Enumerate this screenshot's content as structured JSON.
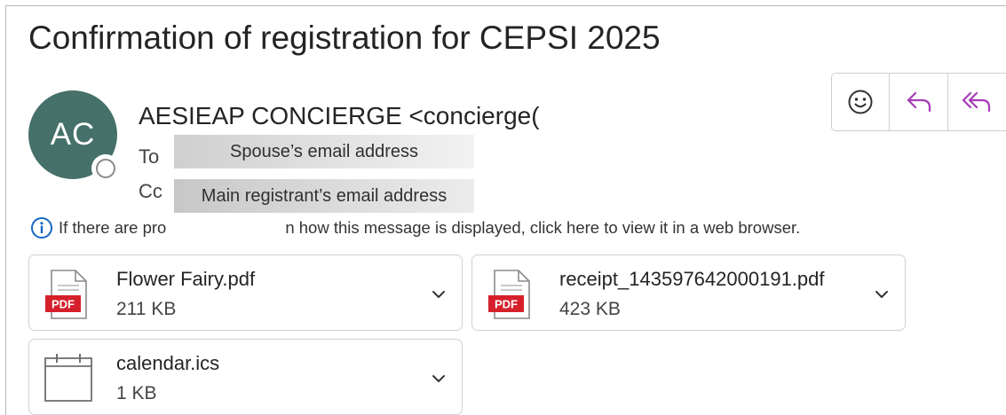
{
  "message": {
    "subject": "Confirmation of registration for CEPSI 2025",
    "sender": {
      "initials": "AC",
      "display": "AESIEAP CONCIERGE <concierge("
    },
    "recipients": {
      "to_label": "To",
      "to_value": "Spouse’s email address",
      "cc_label": "Cc",
      "cc_value": "Main registrant’s email address"
    },
    "info_bar": {
      "text_start": "If there are pro",
      "text_end": "n how this message is displayed, click here to view it in a web browser."
    }
  },
  "attachments": [
    {
      "name": "Flower Fairy.pdf",
      "size": "211 KB",
      "type": "pdf",
      "badge": "PDF"
    },
    {
      "name": "receipt_143597642000191.pdf",
      "size": "423 KB",
      "type": "pdf",
      "badge": "PDF"
    },
    {
      "name": "calendar.ics",
      "size": "1 KB",
      "type": "calendar"
    }
  ],
  "actions": [
    {
      "icon": "smiley-icon"
    },
    {
      "icon": "reply-icon"
    },
    {
      "icon": "reply-all-icon"
    }
  ],
  "colors": {
    "avatar_bg": "#46706a",
    "accent_purple": "#a53bb5",
    "info_blue": "#1368c4",
    "pdf_red": "#d5202b"
  }
}
